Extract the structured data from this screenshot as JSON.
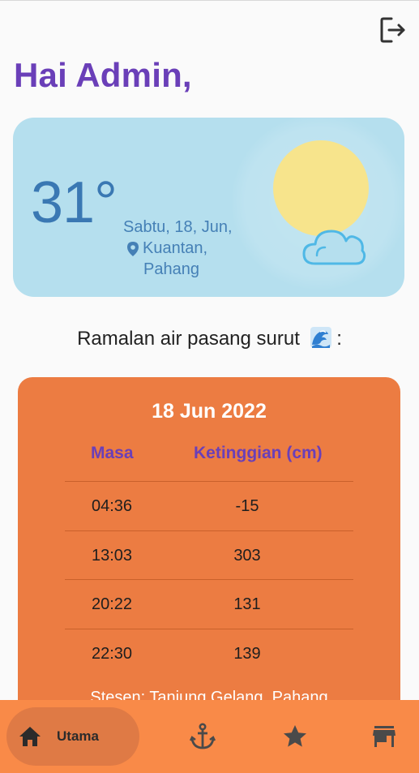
{
  "header": {
    "greeting": "Hai Admin,",
    "logout_icon": "logout-icon"
  },
  "weather": {
    "temperature": "31°",
    "date": "Sabtu, 18, Jun,",
    "location_city": "Kuantan,",
    "location_state": "Pahang",
    "sun_color": "#f7e48c",
    "card_color": "#b5dfee",
    "icons": [
      "sun-icon",
      "cloud-icon",
      "location-pin-icon"
    ]
  },
  "forecast": {
    "title": "Ramalan air pasang surut",
    "title_suffix": ":",
    "title_icon": "wave-emoji-icon"
  },
  "tide_table": {
    "date": "18 Jun 2022",
    "columns": [
      "Masa",
      "Ketinggian (cm)"
    ],
    "rows": [
      {
        "time": "04:36",
        "height": "-15"
      },
      {
        "time": "13:03",
        "height": "303"
      },
      {
        "time": "20:22",
        "height": "131"
      },
      {
        "time": "22:30",
        "height": "139"
      }
    ],
    "station": "Stesen: Tanjung Gelang, Pahang",
    "card_color": "#ec7c42",
    "header_color": "#6a3fb8"
  },
  "bottom_nav": {
    "items": [
      {
        "label": "Utama",
        "icon": "home-icon",
        "active": true
      },
      {
        "label": "",
        "icon": "anchor-icon",
        "active": false
      },
      {
        "label": "",
        "icon": "star-icon",
        "active": false
      },
      {
        "label": "",
        "icon": "store-icon",
        "active": false
      }
    ],
    "bar_color": "#f98a48"
  }
}
